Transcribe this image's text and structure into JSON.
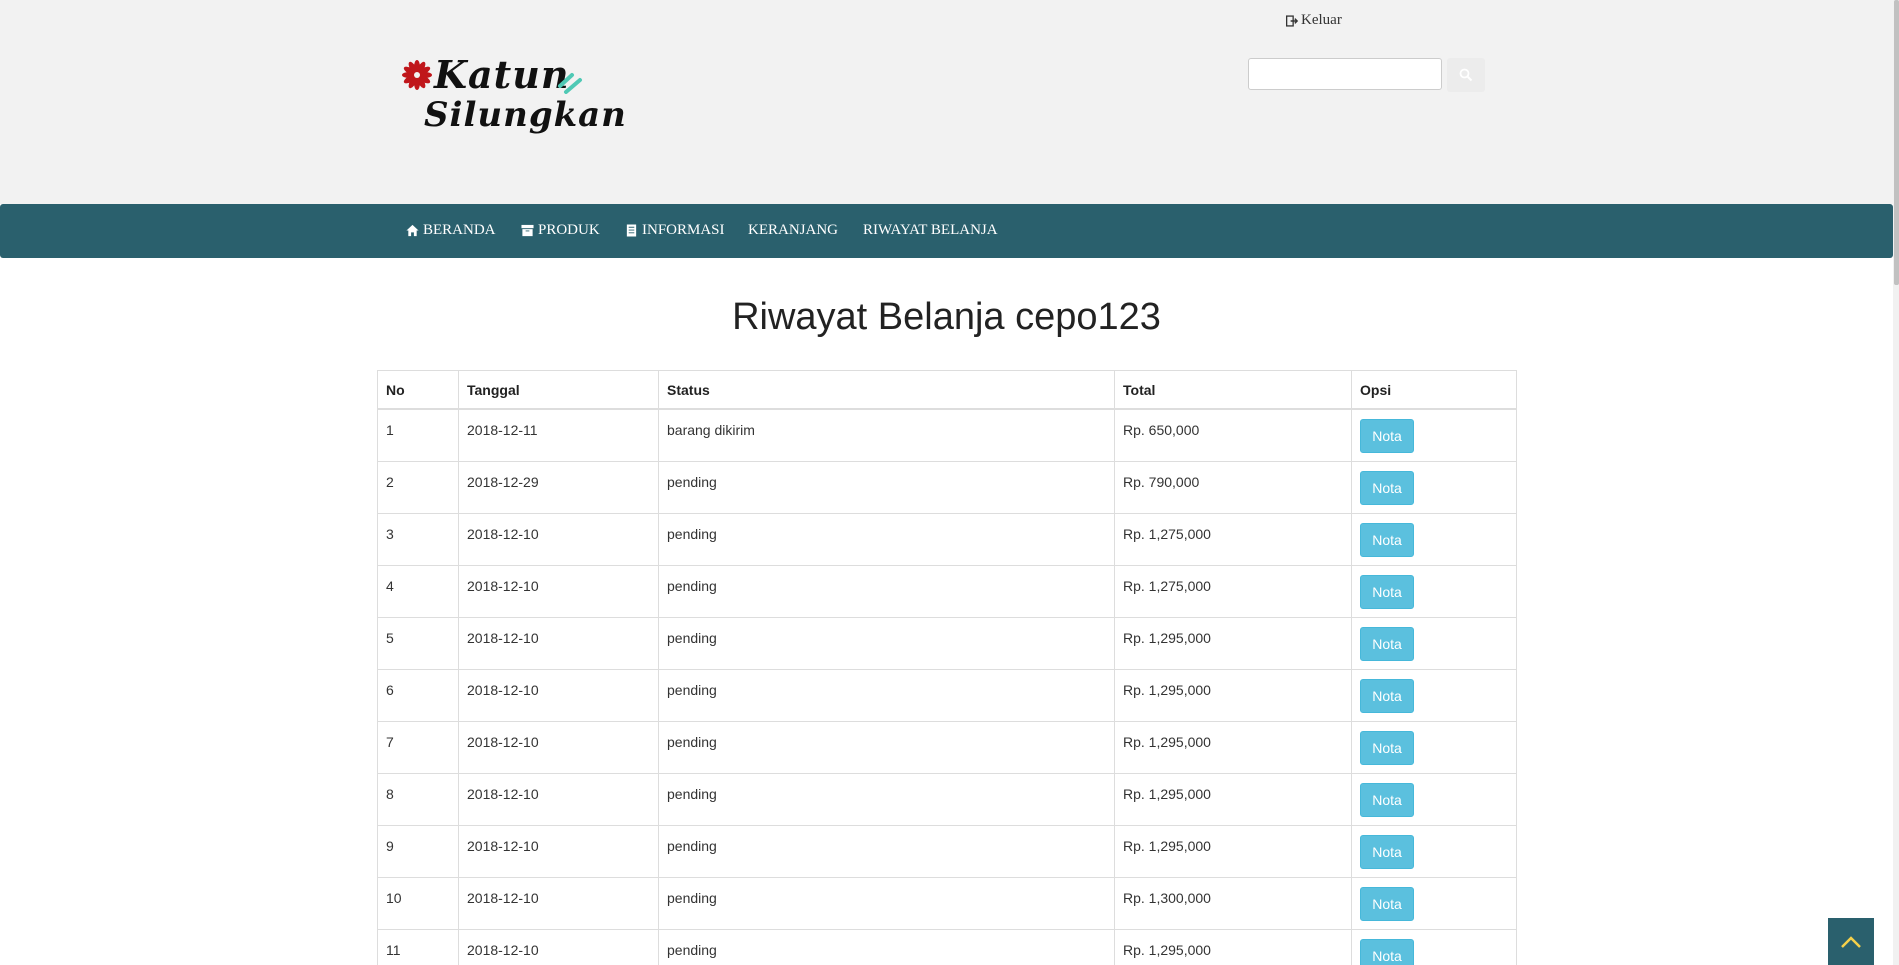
{
  "header": {
    "logout_label": "Keluar",
    "logo": {
      "line1": "Katun",
      "line2": "Silungkan"
    },
    "search": {
      "placeholder": "",
      "value": ""
    }
  },
  "nav": {
    "items": [
      {
        "label": "BERANDA",
        "icon": "home-icon"
      },
      {
        "label": "PRODUK",
        "icon": "archive-icon"
      },
      {
        "label": "INFORMASI",
        "icon": "book-icon"
      },
      {
        "label": "KERANJANG"
      },
      {
        "label": "RIWAYAT BELANJA"
      }
    ]
  },
  "main": {
    "title": "Riwayat Belanja cepo123",
    "table": {
      "headers": [
        "No",
        "Tanggal",
        "Status",
        "Total",
        "Opsi"
      ],
      "rows": [
        {
          "no": "1",
          "tanggal": "2018-12-11",
          "status": "barang dikirim",
          "total": "Rp. 650,000",
          "action": "Nota"
        },
        {
          "no": "2",
          "tanggal": "2018-12-29",
          "status": "pending",
          "total": "Rp. 790,000",
          "action": "Nota"
        },
        {
          "no": "3",
          "tanggal": "2018-12-10",
          "status": "pending",
          "total": "Rp. 1,275,000",
          "action": "Nota"
        },
        {
          "no": "4",
          "tanggal": "2018-12-10",
          "status": "pending",
          "total": "Rp. 1,275,000",
          "action": "Nota"
        },
        {
          "no": "5",
          "tanggal": "2018-12-10",
          "status": "pending",
          "total": "Rp. 1,295,000",
          "action": "Nota"
        },
        {
          "no": "6",
          "tanggal": "2018-12-10",
          "status": "pending",
          "total": "Rp. 1,295,000",
          "action": "Nota"
        },
        {
          "no": "7",
          "tanggal": "2018-12-10",
          "status": "pending",
          "total": "Rp. 1,295,000",
          "action": "Nota"
        },
        {
          "no": "8",
          "tanggal": "2018-12-10",
          "status": "pending",
          "total": "Rp. 1,295,000",
          "action": "Nota"
        },
        {
          "no": "9",
          "tanggal": "2018-12-10",
          "status": "pending",
          "total": "Rp. 1,295,000",
          "action": "Nota"
        },
        {
          "no": "10",
          "tanggal": "2018-12-10",
          "status": "pending",
          "total": "Rp. 1,300,000",
          "action": "Nota"
        },
        {
          "no": "11",
          "tanggal": "2018-12-10",
          "status": "pending",
          "total": "Rp. 1,295,000",
          "action": "Nota"
        }
      ]
    }
  },
  "colors": {
    "header_bg": "#f2f2f2",
    "navbar": "#2a606d",
    "info_button": "#5bc0de",
    "back_to_top": "#2a606d"
  }
}
